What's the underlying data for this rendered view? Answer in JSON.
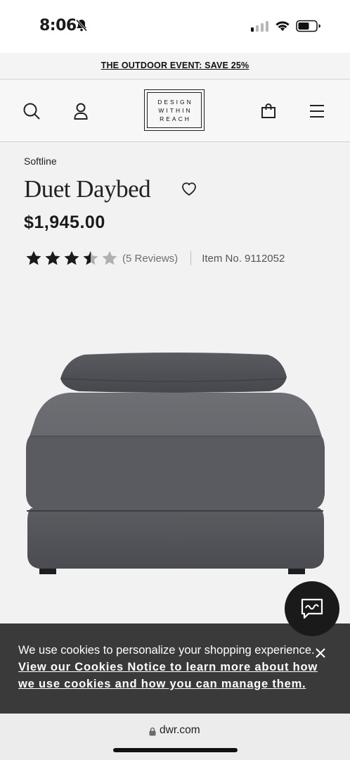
{
  "status": {
    "time": "8:06"
  },
  "promo": {
    "label": "THE OUTDOOR EVENT: SAVE 25%"
  },
  "header": {
    "logo_lines": [
      "DESIGN",
      "WITHIN",
      "REACH"
    ],
    "icons": [
      "search-icon",
      "account-icon",
      "shopping-bag-icon",
      "menu-icon"
    ]
  },
  "product": {
    "brand": "Softline",
    "title": "Duet Daybed",
    "price": "$1,945.00",
    "rating": 3.5,
    "rating_max": 5,
    "reviews": "(5 Reviews)",
    "item_no": "Item No. 9112052"
  },
  "cookie": {
    "text": "We use cookies to personalize your shopping experience. ",
    "link": "View our Cookies Notice to learn more about how we use cookies and how you can manage them."
  },
  "browser": {
    "url": "dwr.com"
  },
  "colors": {
    "accent": "#1a1a1a",
    "cookie_bg": "#3a3a3a",
    "fabric": "#5e5f64"
  }
}
